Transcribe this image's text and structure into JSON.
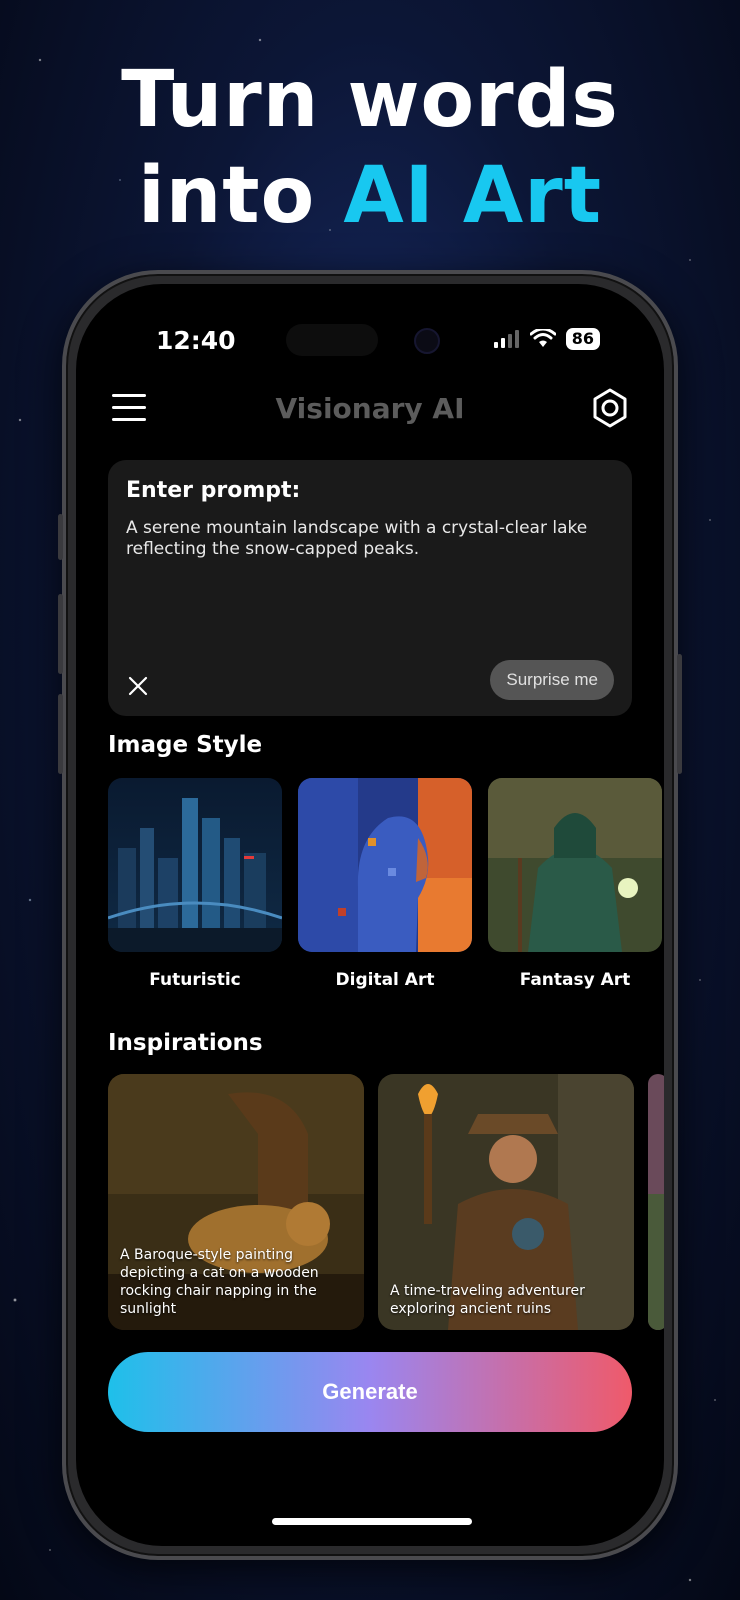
{
  "hero": {
    "line1": "Turn words",
    "line2_prefix": "into",
    "line2_accent": "AI Art",
    "accent_color": "#18c8f0"
  },
  "status_bar": {
    "time": "12:40",
    "battery": "86",
    "icons": [
      "cellular-signal-icon",
      "wifi-icon",
      "battery-icon"
    ]
  },
  "header": {
    "title": "Visionary AI",
    "menu_icon": "hamburger-menu-icon",
    "settings_icon": "hexagon-settings-icon"
  },
  "prompt": {
    "label": "Enter prompt:",
    "value": "A serene mountain landscape with a crystal-clear lake reflecting the snow-capped peaks.",
    "clear_icon": "close-icon",
    "surprise_label": "Surprise me"
  },
  "image_style": {
    "title": "Image Style",
    "items": [
      {
        "label": "Futuristic"
      },
      {
        "label": "Digital Art"
      },
      {
        "label": "Fantasy Art"
      }
    ]
  },
  "inspirations": {
    "title": "Inspirations",
    "items": [
      {
        "caption": "A Baroque-style painting depicting a cat on a wooden rocking chair napping in the sunlight"
      },
      {
        "caption": "A time-traveling adventurer exploring ancient ruins"
      }
    ]
  },
  "generate": {
    "label": "Generate",
    "gradient": [
      "#1ec0ea",
      "#9a86f0",
      "#ef5a6a"
    ]
  }
}
